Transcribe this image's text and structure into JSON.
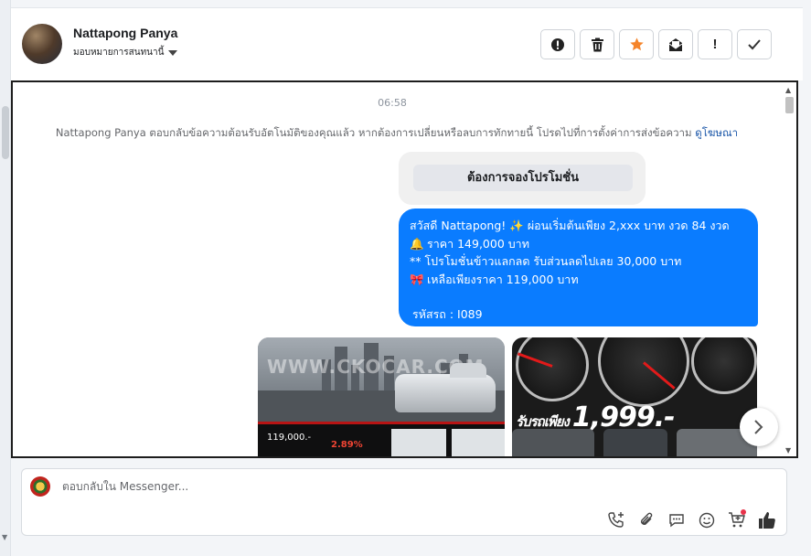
{
  "header": {
    "contact_name": "Nattapong Panya",
    "assign_label": "มอบหมายการสนทนานี้",
    "actions": [
      {
        "name": "spam",
        "icon": "alert-circle-icon",
        "label": "!"
      },
      {
        "name": "delete",
        "icon": "trash-icon"
      },
      {
        "name": "star",
        "icon": "star-icon",
        "color": "#f5842a"
      },
      {
        "name": "mark-unread",
        "icon": "envelope-open-icon"
      },
      {
        "name": "follow-up",
        "icon": "exclamation-icon",
        "label": "!"
      },
      {
        "name": "done",
        "icon": "check-icon"
      }
    ]
  },
  "chat": {
    "timestamp": "06:58",
    "notice_text": "Nattapong Panya ตอบกลับข้อความต้อนรับอัตโนมัติของคุณแล้ว หากต้องการเปลี่ยนหรือลบการทักทายนี้ โปรดไปที่การตั้งค่าการส่งข้อความ",
    "notice_link": "ดูโฆษณา",
    "quick_reply": "ต้องการจองโปรโมชั่น",
    "bubble": {
      "line1_text": "สวัสดี Nattapong!",
      "line1_emoji": "✨",
      "line1_rest": "ผ่อนเริ่มต้นเพียง 2,xxx บาท งวด 84 งวด",
      "line2_emoji": "🔔",
      "line2_text": "ราคา 149,000 บาท",
      "line3_text": "** โปรโมชั่นข้าวแลกลด รับส่วนลดไปเลย 30,000 บาท",
      "line4_emoji": "🎀",
      "line4_text": "เหลือเพียงราคา 119,000 บาท",
      "line5_text": "รหัสรถ : I089"
    },
    "carousel": {
      "card1_watermark": "WWW.CKOCAR.COM",
      "card1_price": "119,000.-",
      "card1_rate": "2.89%",
      "card2_promo_small": "รับรถเพียง",
      "card2_promo": "1,999.-"
    },
    "accent_color": "#0a7cff"
  },
  "composer": {
    "placeholder": "ตอบกลับใน Messenger...",
    "tools": [
      "phone-plus-icon",
      "paperclip-icon",
      "chat-bubble-icon",
      "smiley-icon",
      "cart-plus-icon",
      "thumbs-up-icon"
    ]
  }
}
